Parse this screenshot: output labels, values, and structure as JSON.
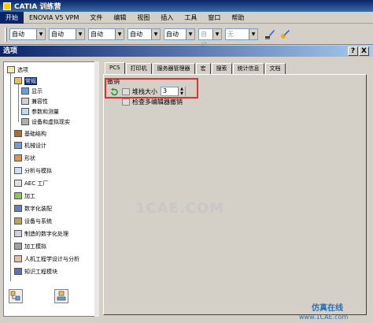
{
  "app": {
    "title": "CATIA 训练营"
  },
  "menu": [
    "开始",
    "ENOVIA V5 VPM",
    "文件",
    "编辑",
    "视图",
    "插入",
    "工具",
    "窗口",
    "帮助"
  ],
  "toolbar": {
    "combos": [
      "自动",
      "自动",
      "自动",
      "自动",
      "自动",
      "自动",
      "无"
    ]
  },
  "dialog": {
    "title": "选项",
    "help_label": "?",
    "close_label": "X"
  },
  "tree": [
    "选项",
    "常规",
    "显示",
    "兼容性",
    "参数和测量",
    "设备和虚拟现实",
    "基础结构",
    "机械设计",
    "形状",
    "分析与模拟",
    "AEC 工厂",
    "加工",
    "数字化装配",
    "设备与系统",
    "制造的数字化处理",
    "加工模拟",
    "人机工程学设计与分析",
    "知识工程模块"
  ],
  "tabs": [
    "PCS",
    "打印机",
    "服务器管理器",
    "宏",
    "搜索",
    "统计信息",
    "文档"
  ],
  "undo": {
    "group_label": "撤销",
    "stack_label": "堆栈大小",
    "stack_value": "3",
    "check_label": "检查多编辑器撤销"
  },
  "watermark": "1CAE.COM",
  "brand": {
    "main": "仿真在线",
    "site": "www.1CAE.com"
  },
  "colors": {
    "title_blue": "#0a246a",
    "highlight": "#dd3333"
  }
}
